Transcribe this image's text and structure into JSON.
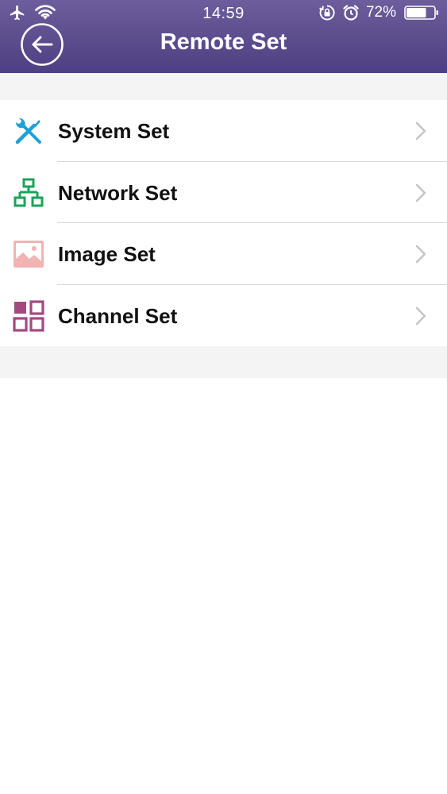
{
  "status_bar": {
    "time": "14:59",
    "battery_percent": "72%",
    "battery_level": 0.72,
    "icons": [
      "airplane-icon",
      "wifi-icon",
      "orientation-lock-icon",
      "alarm-icon",
      "battery-icon"
    ]
  },
  "nav": {
    "title": "Remote Set",
    "back_icon": "back-arrow-icon"
  },
  "menu": {
    "items": [
      {
        "label": "System Set",
        "icon": "wrench-screwdriver-icon",
        "color": "#1da1d8"
      },
      {
        "label": "Network Set",
        "icon": "network-icon",
        "color": "#1aa45a"
      },
      {
        "label": "Image Set",
        "icon": "image-icon",
        "color": "#f2b3b3"
      },
      {
        "label": "Channel Set",
        "icon": "grid-icon",
        "color": "#a24a7e"
      }
    ]
  },
  "colors": {
    "header_top": "#6e5d9c",
    "header_bottom": "#4d3f82",
    "background_gray": "#f4f4f5",
    "chevron": "#c4c4c8"
  }
}
